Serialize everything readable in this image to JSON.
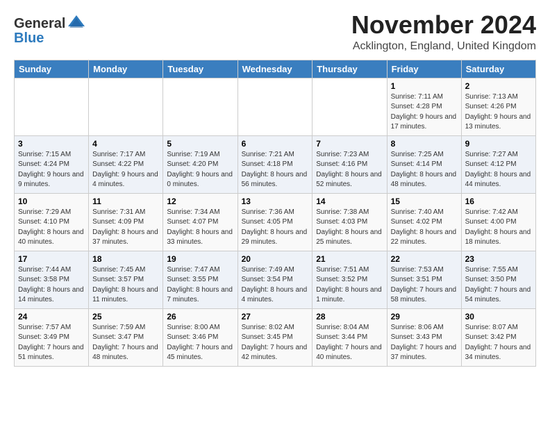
{
  "header": {
    "logo": {
      "general": "General",
      "blue": "Blue"
    },
    "title": "November 2024",
    "location": "Acklington, England, United Kingdom"
  },
  "calendar": {
    "days_of_week": [
      "Sunday",
      "Monday",
      "Tuesday",
      "Wednesday",
      "Thursday",
      "Friday",
      "Saturday"
    ],
    "weeks": [
      [
        {
          "day": "",
          "info": ""
        },
        {
          "day": "",
          "info": ""
        },
        {
          "day": "",
          "info": ""
        },
        {
          "day": "",
          "info": ""
        },
        {
          "day": "",
          "info": ""
        },
        {
          "day": "1",
          "info": "Sunrise: 7:11 AM\nSunset: 4:28 PM\nDaylight: 9 hours and 17 minutes."
        },
        {
          "day": "2",
          "info": "Sunrise: 7:13 AM\nSunset: 4:26 PM\nDaylight: 9 hours and 13 minutes."
        }
      ],
      [
        {
          "day": "3",
          "info": "Sunrise: 7:15 AM\nSunset: 4:24 PM\nDaylight: 9 hours and 9 minutes."
        },
        {
          "day": "4",
          "info": "Sunrise: 7:17 AM\nSunset: 4:22 PM\nDaylight: 9 hours and 4 minutes."
        },
        {
          "day": "5",
          "info": "Sunrise: 7:19 AM\nSunset: 4:20 PM\nDaylight: 9 hours and 0 minutes."
        },
        {
          "day": "6",
          "info": "Sunrise: 7:21 AM\nSunset: 4:18 PM\nDaylight: 8 hours and 56 minutes."
        },
        {
          "day": "7",
          "info": "Sunrise: 7:23 AM\nSunset: 4:16 PM\nDaylight: 8 hours and 52 minutes."
        },
        {
          "day": "8",
          "info": "Sunrise: 7:25 AM\nSunset: 4:14 PM\nDaylight: 8 hours and 48 minutes."
        },
        {
          "day": "9",
          "info": "Sunrise: 7:27 AM\nSunset: 4:12 PM\nDaylight: 8 hours and 44 minutes."
        }
      ],
      [
        {
          "day": "10",
          "info": "Sunrise: 7:29 AM\nSunset: 4:10 PM\nDaylight: 8 hours and 40 minutes."
        },
        {
          "day": "11",
          "info": "Sunrise: 7:31 AM\nSunset: 4:09 PM\nDaylight: 8 hours and 37 minutes."
        },
        {
          "day": "12",
          "info": "Sunrise: 7:34 AM\nSunset: 4:07 PM\nDaylight: 8 hours and 33 minutes."
        },
        {
          "day": "13",
          "info": "Sunrise: 7:36 AM\nSunset: 4:05 PM\nDaylight: 8 hours and 29 minutes."
        },
        {
          "day": "14",
          "info": "Sunrise: 7:38 AM\nSunset: 4:03 PM\nDaylight: 8 hours and 25 minutes."
        },
        {
          "day": "15",
          "info": "Sunrise: 7:40 AM\nSunset: 4:02 PM\nDaylight: 8 hours and 22 minutes."
        },
        {
          "day": "16",
          "info": "Sunrise: 7:42 AM\nSunset: 4:00 PM\nDaylight: 8 hours and 18 minutes."
        }
      ],
      [
        {
          "day": "17",
          "info": "Sunrise: 7:44 AM\nSunset: 3:58 PM\nDaylight: 8 hours and 14 minutes."
        },
        {
          "day": "18",
          "info": "Sunrise: 7:45 AM\nSunset: 3:57 PM\nDaylight: 8 hours and 11 minutes."
        },
        {
          "day": "19",
          "info": "Sunrise: 7:47 AM\nSunset: 3:55 PM\nDaylight: 8 hours and 7 minutes."
        },
        {
          "day": "20",
          "info": "Sunrise: 7:49 AM\nSunset: 3:54 PM\nDaylight: 8 hours and 4 minutes."
        },
        {
          "day": "21",
          "info": "Sunrise: 7:51 AM\nSunset: 3:52 PM\nDaylight: 8 hours and 1 minute."
        },
        {
          "day": "22",
          "info": "Sunrise: 7:53 AM\nSunset: 3:51 PM\nDaylight: 7 hours and 58 minutes."
        },
        {
          "day": "23",
          "info": "Sunrise: 7:55 AM\nSunset: 3:50 PM\nDaylight: 7 hours and 54 minutes."
        }
      ],
      [
        {
          "day": "24",
          "info": "Sunrise: 7:57 AM\nSunset: 3:49 PM\nDaylight: 7 hours and 51 minutes."
        },
        {
          "day": "25",
          "info": "Sunrise: 7:59 AM\nSunset: 3:47 PM\nDaylight: 7 hours and 48 minutes."
        },
        {
          "day": "26",
          "info": "Sunrise: 8:00 AM\nSunset: 3:46 PM\nDaylight: 7 hours and 45 minutes."
        },
        {
          "day": "27",
          "info": "Sunrise: 8:02 AM\nSunset: 3:45 PM\nDaylight: 7 hours and 42 minutes."
        },
        {
          "day": "28",
          "info": "Sunrise: 8:04 AM\nSunset: 3:44 PM\nDaylight: 7 hours and 40 minutes."
        },
        {
          "day": "29",
          "info": "Sunrise: 8:06 AM\nSunset: 3:43 PM\nDaylight: 7 hours and 37 minutes."
        },
        {
          "day": "30",
          "info": "Sunrise: 8:07 AM\nSunset: 3:42 PM\nDaylight: 7 hours and 34 minutes."
        }
      ]
    ]
  }
}
